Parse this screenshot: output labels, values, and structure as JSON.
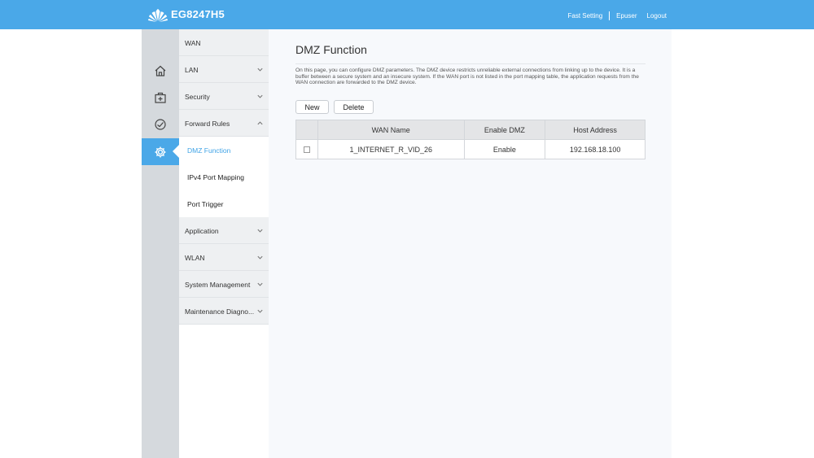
{
  "header": {
    "model": "EG8247H5",
    "links": {
      "fast_setting": "Fast Setting",
      "user": "Epuser",
      "logout": "Logout"
    },
    "bg_color": "#4aa8e8"
  },
  "iconbar": {
    "items": [
      {
        "icon": "home-icon"
      },
      {
        "icon": "toolbox-icon"
      },
      {
        "icon": "diagnostic-gauge-icon"
      },
      {
        "icon": "gear-icon",
        "active": true
      }
    ]
  },
  "sidebar": {
    "items": [
      {
        "label": "WAN"
      },
      {
        "label": "LAN"
      },
      {
        "label": "Security"
      },
      {
        "label": "Forward Rules",
        "expanded": true
      },
      {
        "label": "Application"
      },
      {
        "label": "WLAN"
      },
      {
        "label": "System Management"
      },
      {
        "label": "Maintenance Diagno..."
      }
    ],
    "subitems": [
      {
        "label": "DMZ Function",
        "active": true
      },
      {
        "label": "IPv4 Port Mapping"
      },
      {
        "label": "Port Trigger"
      }
    ]
  },
  "main": {
    "title": "DMZ Function",
    "description": "On this page, you can configure DMZ parameters. The DMZ device restricts unreliable external connections from linking up to the device. It is a buffer between a secure system and an insecure system. If the WAN port is not listed in the port mapping table, the application requests from the WAN connection are forwarded to the DMZ device.",
    "buttons": {
      "new": "New",
      "delete": "Delete"
    },
    "table": {
      "headers": [
        "",
        "WAN Name",
        "Enable DMZ",
        "Host Address"
      ],
      "rows": [
        {
          "checked": false,
          "wan_name": "1_INTERNET_R_VID_26",
          "enable_dmz": "Enable",
          "host_address": "192.168.18.100"
        }
      ]
    }
  }
}
